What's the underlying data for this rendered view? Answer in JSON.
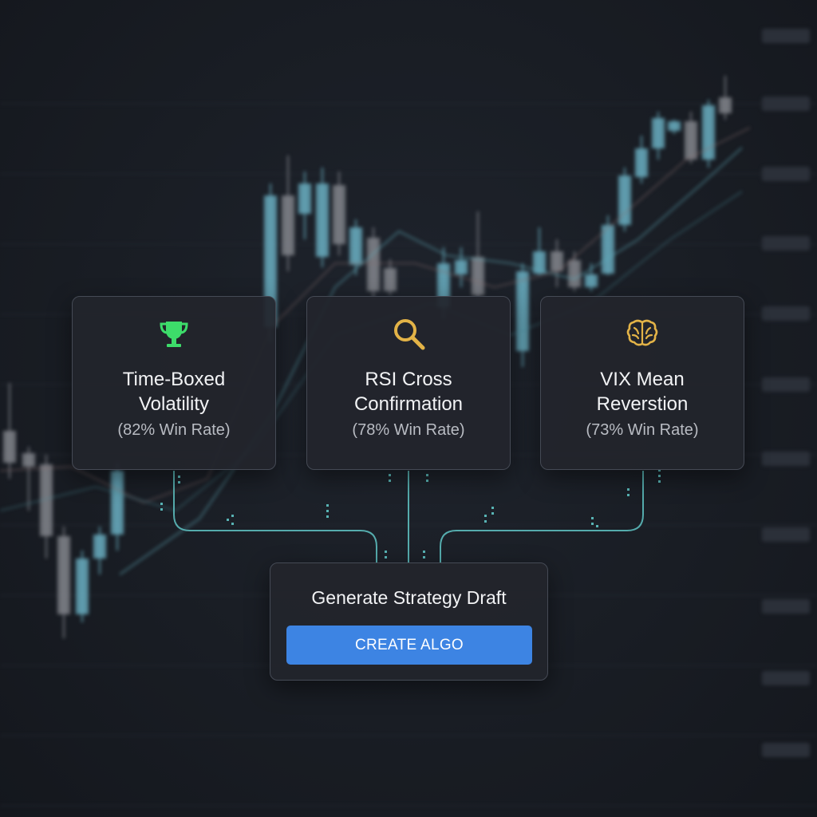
{
  "strategies": [
    {
      "icon": "trophy-icon",
      "title_line1": "Time-Boxed",
      "title_line2": "Volatility",
      "win_rate": "(82% Win Rate)",
      "icon_color": "#3ddc6a"
    },
    {
      "icon": "magnifier-icon",
      "title_line1": "RSI Cross",
      "title_line2": "Confirmation",
      "win_rate": "(78% Win Rate)",
      "icon_color": "#e3b347"
    },
    {
      "icon": "brain-icon",
      "title_line1": "VIX Mean",
      "title_line2": "Reverstion",
      "win_rate": "(73% Win Rate)",
      "icon_color": "#e3b347"
    }
  ],
  "generator": {
    "title": "Generate Strategy Draft",
    "button_label": "CREATE ALGO"
  },
  "colors": {
    "accent": "#3d84e3",
    "connector": "#5fc4c4",
    "bull_candle": "#6fb8cc",
    "bear_candle": "#8a8c93"
  }
}
